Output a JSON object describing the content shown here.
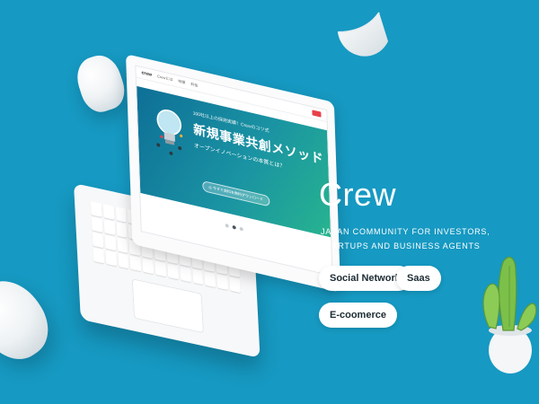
{
  "colors": {
    "background": "#1699c2",
    "pill_bg": "#ffffff",
    "pill_text": "#1c2b33",
    "title_text": "#ffffff"
  },
  "laptop_screen": {
    "site_logo": "crew",
    "nav_items": [
      "Crewとは",
      "特徴",
      "料金"
    ],
    "hero_small": "100社以上の採用実績！Crewのコツ式",
    "hero_title": "新規事業共創メソッド",
    "hero_sub": "オープンイノベーションの本質とは？",
    "hero_cta": "◎ 今すぐ資料を無料ダウンロード",
    "carousel_active": 2,
    "carousel_count": 3
  },
  "app": {
    "title": "Crew",
    "tagline": "JAPAN COMMUNITY FOR INVESTORS, STARTUPS AND BUSINESS AGENTS",
    "tags": [
      "Social Network",
      "Saas",
      "E-coomerce"
    ]
  },
  "icons": {
    "bulb": "lightbulb-icon",
    "plant": "cactus-plant-icon"
  }
}
